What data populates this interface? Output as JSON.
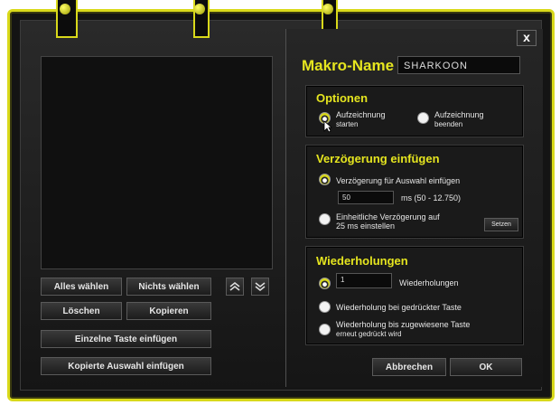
{
  "close_label": "x",
  "makro": {
    "label": "Makro-Name",
    "value": "SHARKOON"
  },
  "optionen": {
    "title": "Optionen",
    "start_line1": "Aufzeichnung",
    "start_line2": "starten",
    "end_line1": "Aufzeichnung",
    "end_line2": "beenden"
  },
  "verzoegerung": {
    "title": "Verzögerung einfügen",
    "option1": "Verzögerung für Auswahl einfügen",
    "ms_value": "50",
    "ms_range": "ms (50 - 12.750)",
    "option2_line1": "Einheitliche Verzögerung auf",
    "option2_line2": "25 ms einstellen",
    "setzen_label": "Setzen"
  },
  "wiederholungen": {
    "title": "Wiederholungen",
    "count_value": "1",
    "count_label": "Wiederholungen",
    "option2": "Wiederholung bei gedrückter Taste",
    "option3_line1": "Wiederholung bis zugewiesene Taste",
    "option3_line2": "erneut gedrückt wird"
  },
  "buttons": {
    "alles": "Alles wählen",
    "nichts": "Nichts wählen",
    "loeschen": "Löschen",
    "kopieren": "Kopieren",
    "einzelne": "Einzelne Taste einfügen",
    "kopierte": "Kopierte Auswahl einfügen",
    "abbrechen": "Abbrechen",
    "ok": "OK"
  },
  "colors": {
    "accent": "#e5e51f",
    "background": "#141414"
  }
}
